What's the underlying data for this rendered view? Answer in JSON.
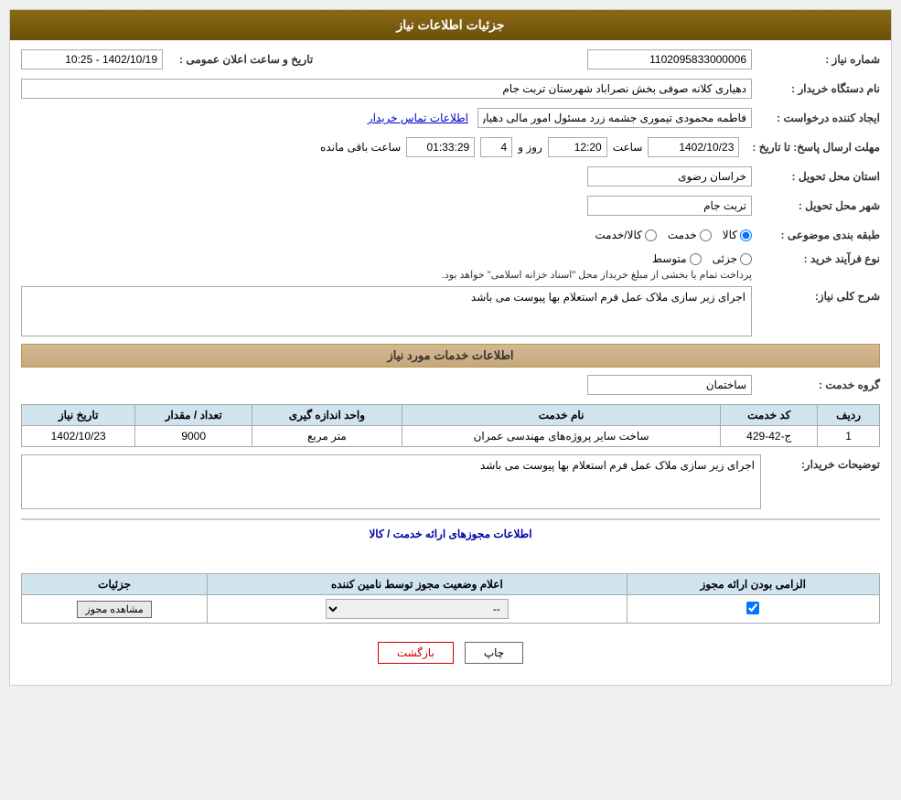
{
  "header": {
    "title": "جزئیات اطلاعات نیاز"
  },
  "fields": {
    "need_number_label": "شماره نیاز :",
    "need_number_value": "1102095833000006",
    "buyer_label": "نام دستگاه خریدار :",
    "buyer_value": "دهیاری کلانه صوفی بخش نصراباد شهرستان تربت جام",
    "creator_label": "ایجاد کننده درخواست :",
    "creator_value": "فاطمه محمودی تیموری جشمه زرد مسئول امور مالی دهیاری کلانه صوفی بخش",
    "contact_link": "اطلاعات تماس خریدار",
    "deadline_label": "مهلت ارسال پاسخ: تا تاریخ :",
    "deadline_date": "1402/10/23",
    "deadline_time_label": "ساعت",
    "deadline_time": "12:20",
    "deadline_days_label": "روز و",
    "deadline_days": "4",
    "remaining_label": "ساعت باقی مانده",
    "remaining_time": "01:33:29",
    "province_label": "استان محل تحویل :",
    "province_value": "خراسان رضوی",
    "city_label": "شهر محل تحویل :",
    "city_value": "تربت جام",
    "datetime_label": "تاریخ و ساعت اعلان عمومی :",
    "datetime_value": "1402/10/19 - 10:25",
    "category_label": "طبقه بندی موضوعی :",
    "category_options": [
      "کالا",
      "خدمت",
      "کالا/خدمت"
    ],
    "category_selected": "کالا",
    "purchase_type_label": "نوع فرآیند خرید :",
    "purchase_types": [
      "جزئی",
      "متوسط",
      ""
    ],
    "purchase_note": "پرداخت تمام یا بخشی از مبلغ خریداز محل \"اسناد خزانه اسلامی\" خواهد بود.",
    "need_description_label": "شرح کلی نیاز:",
    "need_description": "اجرای زیر سازی ملاک عمل فرم استعلام بها پیوست می باشد",
    "services_header": "اطلاعات خدمات مورد نیاز",
    "service_group_label": "گروه خدمت :",
    "service_group_value": "ساختمان",
    "table": {
      "headers": [
        "ردیف",
        "کد خدمت",
        "نام خدمت",
        "واحد اندازه گیری",
        "تعداد / مقدار",
        "تاریخ نیاز"
      ],
      "rows": [
        {
          "row": "1",
          "code": "ج-42-429",
          "name": "ساخت سایر پروژه‌های مهندسی عمران",
          "unit": "متر مربع",
          "quantity": "9000",
          "date": "1402/10/23"
        }
      ]
    },
    "buyer_notes_label": "توضیحات خریدار:",
    "buyer_notes": "اجرای زیر سازی ملاک عمل فرم استعلام بها پیوست می باشد",
    "license_header": "اطلاعات مجوزهای ارائه خدمت / کالا",
    "license_table": {
      "headers": [
        "الزامی بودن ارائه مجوز",
        "اعلام وضعیت مجوز توسط نامین کننده",
        "جزئیات"
      ],
      "rows": [
        {
          "required": true,
          "status": "--",
          "detail": "مشاهده مجوز"
        }
      ]
    }
  },
  "buttons": {
    "print": "چاپ",
    "back": "بازگشت"
  }
}
